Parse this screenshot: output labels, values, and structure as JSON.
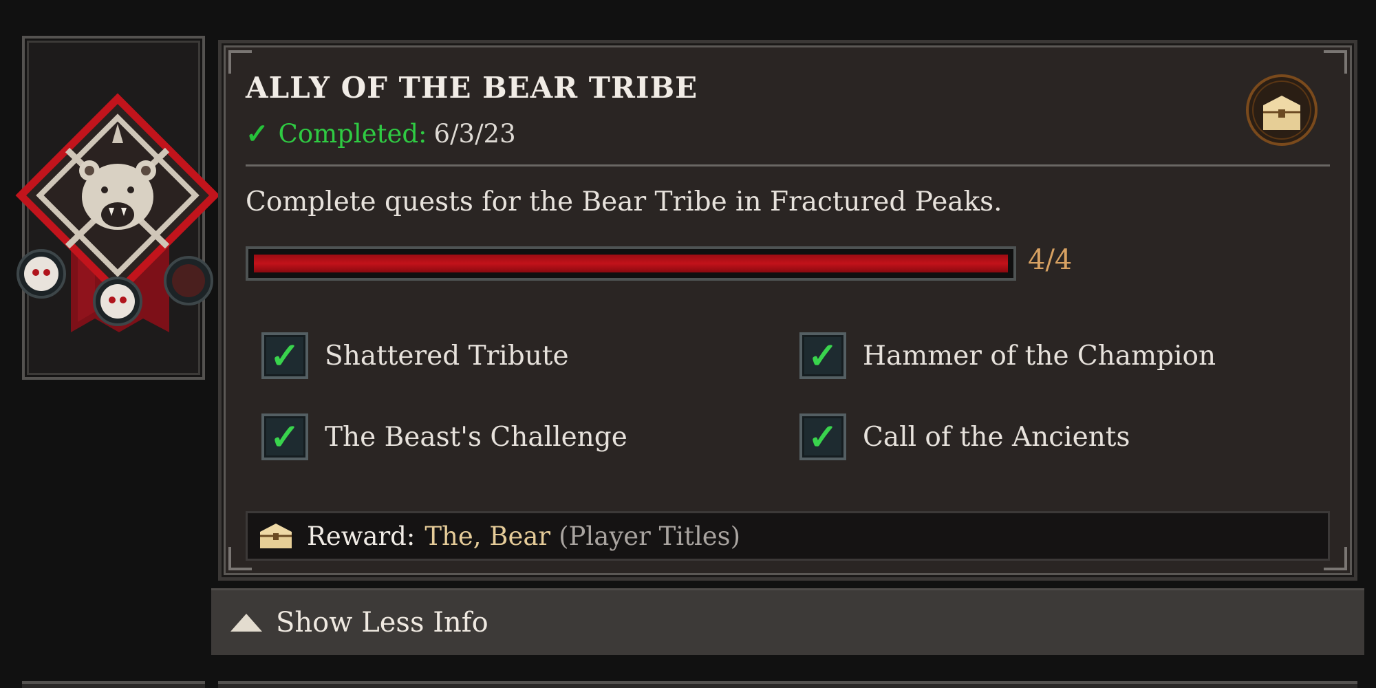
{
  "achievement": {
    "title": "ALLY OF THE BEAR TRIBE",
    "status_label": "Completed:",
    "completed_date": "6/3/23",
    "description": "Complete quests for the Bear Tribe in Fractured Peaks.",
    "progress": {
      "current": 4,
      "total": 4,
      "text": "4/4",
      "fraction": 1.0
    },
    "reward_icon": "chest-icon"
  },
  "objectives": [
    {
      "label": "Shattered Tribute",
      "completed": true
    },
    {
      "label": "Hammer of the Champion",
      "completed": true
    },
    {
      "label": "The Beast's Challenge",
      "completed": true
    },
    {
      "label": "Call of the Ancients",
      "completed": true
    }
  ],
  "reward": {
    "label": "Reward:",
    "value": "The, Bear",
    "type": "(Player Titles)"
  },
  "footer": {
    "show_less_label": "Show Less Info"
  },
  "colors": {
    "completed_green": "#2fcb43",
    "progress_red": "#c2121a",
    "progress_text": "#d7a162",
    "reward_value": "#e6cc99"
  }
}
